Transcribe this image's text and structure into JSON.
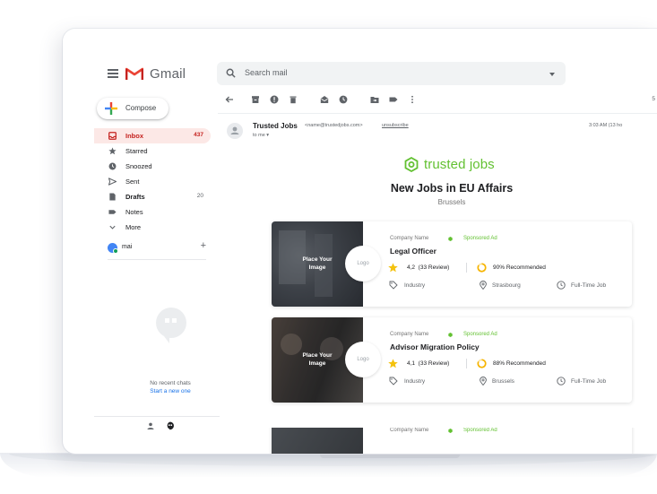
{
  "app": {
    "name": "Gmail"
  },
  "search": {
    "placeholder": "Search mail"
  },
  "compose": {
    "label": "Compose"
  },
  "sidebar": {
    "items": [
      {
        "label": "Inbox",
        "count": "437"
      },
      {
        "label": "Starred",
        "count": ""
      },
      {
        "label": "Snoozed",
        "count": ""
      },
      {
        "label": "Sent",
        "count": ""
      },
      {
        "label": "Drafts",
        "count": "20"
      },
      {
        "label": "Notes",
        "count": ""
      },
      {
        "label": "More",
        "count": ""
      }
    ],
    "user": {
      "name": "mai"
    }
  },
  "chat": {
    "empty": "No recent chats",
    "start": "Start a new one"
  },
  "toolbar": {
    "page_indicator": "5"
  },
  "email": {
    "sender": "Trusted Jobs",
    "sender_email": "<name@trustedjobs.com>",
    "unsubscribe": "unsubscribe",
    "to": "to me",
    "time": "3:03 AM (13 ho"
  },
  "newsletter": {
    "brand": "trusted jobs",
    "headline": "New Jobs in EU Affairs",
    "location": "Brussels",
    "jobs": [
      {
        "image_text_1": "Place Your",
        "image_text_2": "Image",
        "logo": "Logo",
        "company": "Company Name",
        "sponsored": "Sponsored Ad",
        "title": "Legal Officer",
        "rating": "4,2",
        "reviews": "(33 Review)",
        "recommended": "90% Recommended",
        "industry": "Industry",
        "city": "Strasbourg",
        "type": "Full-Time Job"
      },
      {
        "image_text_1": "Place Your",
        "image_text_2": "Image",
        "logo": "Logo",
        "company": "Company Name",
        "sponsored": "Sponsored Ad",
        "title": "Advisor Migration Policy",
        "rating": "4,1",
        "reviews": "(33 Review)",
        "recommended": "88% Recommended",
        "industry": "Industry",
        "city": "Brussels",
        "type": "Full-Time Job"
      },
      {
        "company": "Company Name",
        "sponsored": "Sponsored Ad"
      }
    ]
  },
  "colors": {
    "brand_green": "#63c132",
    "inbox_red": "#c5221f",
    "link_blue": "#1a73e8",
    "star_yellow": "#f4c20d"
  }
}
